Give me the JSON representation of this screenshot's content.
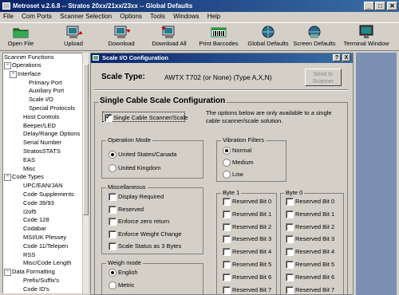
{
  "window": {
    "title": "Metroset v.2.6.8 -- Stratos 20xx/21xx/23xx -- Global Defaults",
    "minimize": "_",
    "maximize": "□",
    "close": "✕"
  },
  "menu": [
    "File",
    "Com Ports",
    "Scanner Selection",
    "Options",
    "Tools",
    "Windows",
    "Help"
  ],
  "toolbar": [
    "Open File",
    "Upload",
    "Download",
    "Download All",
    "Print Barcodes",
    "Global Defaults",
    "Screen Defaults",
    "Terminal Window"
  ],
  "tree": {
    "root": "Scanner Functions",
    "nodes": [
      {
        "label": "Operations",
        "indent": 1,
        "pm": "−"
      },
      {
        "label": "Interface",
        "indent": 2,
        "pm": "−"
      },
      {
        "label": "Primary Port",
        "indent": 4
      },
      {
        "label": "Auxiliary Port",
        "indent": 4
      },
      {
        "label": "Scale I/O",
        "indent": 4
      },
      {
        "label": "Special Protocols",
        "indent": 4
      },
      {
        "label": "Host Controls",
        "indent": 3
      },
      {
        "label": "Beeper/LED",
        "indent": 3
      },
      {
        "label": "Delay/Range Options",
        "indent": 3
      },
      {
        "label": "Serial Number",
        "indent": 3
      },
      {
        "label": "StratosSTATS",
        "indent": 3
      },
      {
        "label": "EAS",
        "indent": 3
      },
      {
        "label": "Misc",
        "indent": 3
      },
      {
        "label": "Code Types",
        "indent": 1,
        "pm": "−"
      },
      {
        "label": "UPC/EAN/JAN",
        "indent": 3
      },
      {
        "label": "Code Supplements",
        "indent": 3
      },
      {
        "label": "Code 39/93",
        "indent": 3
      },
      {
        "label": "I2of5",
        "indent": 3
      },
      {
        "label": "Code 128",
        "indent": 3
      },
      {
        "label": "Codabar",
        "indent": 3
      },
      {
        "label": "MSI/UK Plessey",
        "indent": 3
      },
      {
        "label": "Code 11/Telepen",
        "indent": 3
      },
      {
        "label": "RSS",
        "indent": 3
      },
      {
        "label": "Misc/Code Length",
        "indent": 3
      },
      {
        "label": "Data Formatting",
        "indent": 1,
        "pm": "−"
      },
      {
        "label": "Prefix/Suffix's",
        "indent": 3
      },
      {
        "label": "Code ID's",
        "indent": 3
      }
    ]
  },
  "dialog": {
    "title": "Scale I/O Configuration",
    "help": "?",
    "close": "X",
    "scale_type_label": "Scale Type:",
    "scale_type_value": "AWTX T702 (or None) (Type A,X,N)",
    "send_button": "Send to Scanner",
    "section_title": "Single Cable Scale Configuration",
    "single_cable_checkbox": "Single Cable Scanner/Scale",
    "single_cable_note": "The options below are only available to a single cable scanner/scale solution.",
    "operation_mode": {
      "title": "Operation Mode",
      "options": [
        "United States/Canada",
        "United Kingdom"
      ],
      "selected": 0
    },
    "vibration": {
      "title": "Vibration Filters",
      "options": [
        "Normal",
        "Medium",
        "Low"
      ],
      "selected": 0
    },
    "misc": {
      "title": "Miscellaneous",
      "options": [
        "Display Required",
        "Reserved",
        "Enforce zero return",
        "Enforce Weight Change",
        "Scale Status as 3 Bytes"
      ]
    },
    "weigh_mode": {
      "title": "Weigh mode",
      "options": [
        "English",
        "Metric"
      ],
      "selected": 0
    },
    "byte1": {
      "title": "Byte 1",
      "options": [
        "Reserved Bit 0",
        "Reserved Bit 1",
        "Reserved Bit 2",
        "Reserved Bit 3",
        "Reserved Bit 4",
        "Reserved Bit 5",
        "Reserved Bit 6",
        "Reserved Bit 7"
      ]
    },
    "byte0": {
      "title": "Byte 0",
      "options": [
        "Reserved Bit 0",
        "Reserved Bit 1",
        "Reserved Bit 2",
        "Reserved Bit 3",
        "Reserved Bit 4",
        "Reserved Bit 5",
        "Reserved Bit 6",
        "Reserved Bit 7"
      ]
    }
  }
}
